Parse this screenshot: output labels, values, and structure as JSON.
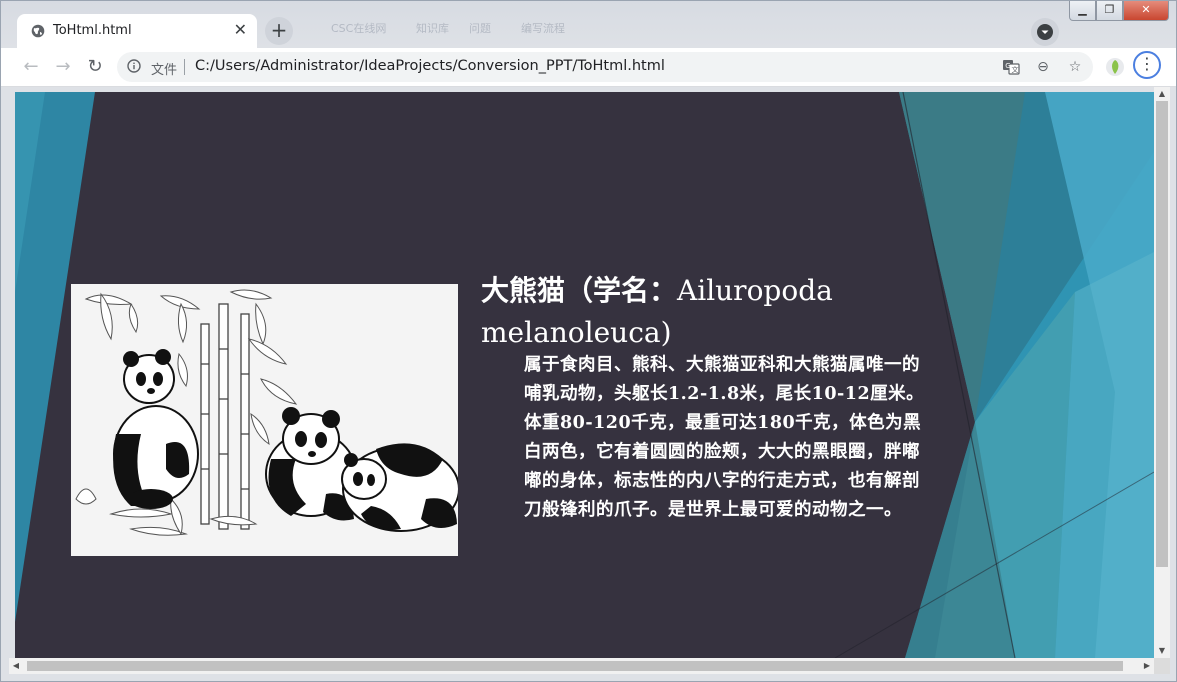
{
  "window": {
    "controls": {
      "minimize": "▁",
      "maximize": "❐",
      "close": "✕"
    }
  },
  "tab": {
    "title": "ToHtml.html",
    "close": "✕",
    "new_tab": "+"
  },
  "background_tabs": [
    "CSC在线网",
    "知识库",
    "问题",
    "编写流程"
  ],
  "toolbar": {
    "back": "←",
    "forward": "→",
    "reload": "↻",
    "scheme_label": "文件",
    "url": "C:/Users/Administrator/IdeaProjects/Conversion_PPT/ToHtml.html",
    "icons": [
      "translate-icon",
      "zoom-out-icon",
      "bookmark-star-icon",
      "extension-icon",
      "menu-icon"
    ],
    "menu": "⋮",
    "zoom": "⊖",
    "star": "☆"
  },
  "slide": {
    "title_cn": "大熊猫（学名：",
    "title_latin": "Ailuropoda melanoleuca)",
    "body": "属于食肉目、熊科、大熊猫亚科和大熊猫属唯一的哺乳动物，头躯长1.2-1.8米，尾长10-12厘米。体重80-120千克，最重可达180千克，体色为黑白两色，它有着圆圆的脸颊，大大的黑眼圈，胖嘟嘟的身体，标志性的内八字的行走方式，也有解剖刀般锋利的爪子。是世界上最可爱的动物之一。",
    "image": "panda-illustration",
    "colors": {
      "background": "#36323f",
      "accent_teal": "#2b8fa8",
      "accent_light": "#5fb3c9",
      "text": "#ffffff"
    }
  },
  "scrollbars": {
    "up": "▲",
    "down": "▼",
    "left": "◀",
    "right": "▶"
  }
}
